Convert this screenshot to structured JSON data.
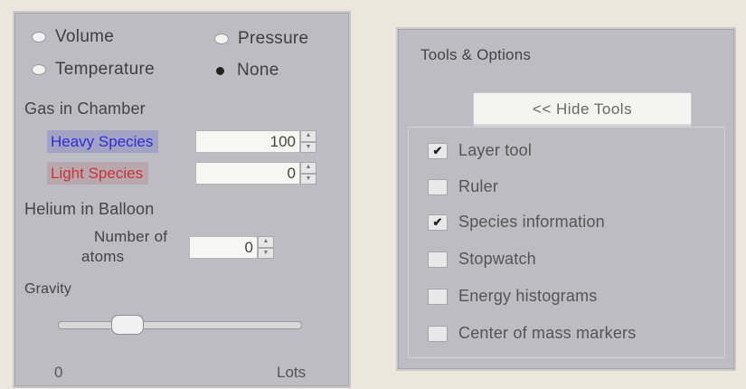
{
  "graph_options": {
    "radios": [
      {
        "label": "Volume",
        "selected": false
      },
      {
        "label": "Pressure",
        "selected": false
      },
      {
        "label": "Temperature",
        "selected": false
      },
      {
        "label": "None",
        "selected": true
      }
    ]
  },
  "gas_in_chamber": {
    "title": "Gas in Chamber",
    "heavy_label": "Heavy Species",
    "heavy_value": "100",
    "light_label": "Light Species",
    "light_value": "0",
    "heavy_color": "#2d2dd6",
    "light_color": "#c8323a"
  },
  "helium_in_balloon": {
    "title": "Helium in Balloon",
    "atoms_label_line1": "Number of",
    "atoms_label_line2": "atoms",
    "atoms_value": "0"
  },
  "gravity": {
    "title": "Gravity",
    "min_label": "0",
    "max_label": "Lots",
    "level_fraction": 0.25
  },
  "tools": {
    "title": "Tools & Options",
    "hide_button_label": "<< Hide Tools",
    "options": [
      {
        "label": "Layer tool",
        "checked": true
      },
      {
        "label": "Ruler",
        "checked": false
      },
      {
        "label": "Species information",
        "checked": true
      },
      {
        "label": "Stopwatch",
        "checked": false
      },
      {
        "label": "Energy histograms",
        "checked": false
      },
      {
        "label": "Center of mass markers",
        "checked": false
      }
    ]
  },
  "icons": {
    "spinner_up": "triangle-up-icon",
    "spinner_down": "triangle-down-icon",
    "checkmark": "checkmark-icon"
  }
}
